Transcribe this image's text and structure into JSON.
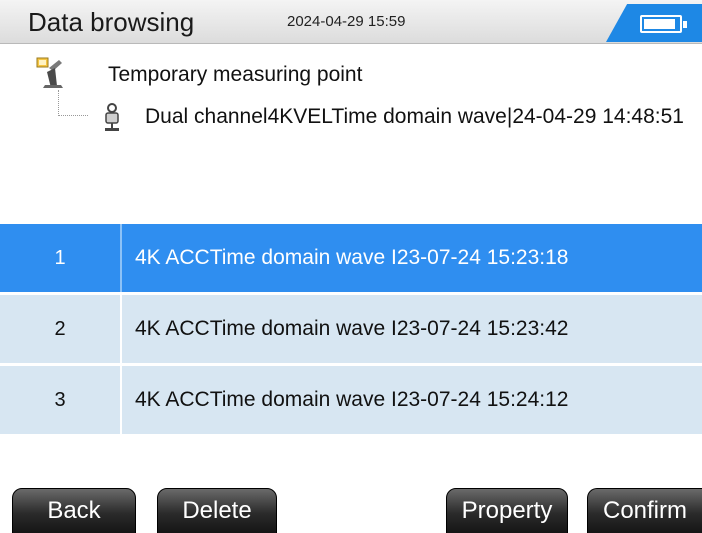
{
  "header": {
    "title": "Data browsing",
    "datetime": "2024-04-29 15:59",
    "battery_level": 0.85,
    "accent_color": "#1e88e5"
  },
  "tree": {
    "root": {
      "label": "Temporary measuring point",
      "icon": "measuring-point-icon"
    },
    "child": {
      "label": "Dual channel4KVELTime domain wave|24-04-29 14:48:51",
      "icon": "sensor-icon"
    }
  },
  "list": {
    "rows": [
      {
        "index": "1",
        "label": "4K ACCTime domain wave I23-07-24 15:23:18",
        "selected": true
      },
      {
        "index": "2",
        "label": "4K ACCTime domain wave I23-07-24 15:23:42",
        "selected": false
      },
      {
        "index": "3",
        "label": "4K ACCTime domain wave I23-07-24 15:24:12",
        "selected": false
      }
    ],
    "selected_color": "#2f8ef0",
    "row_color": "#d7e6f2"
  },
  "buttons": {
    "back": "Back",
    "delete": "Delete",
    "property": "Property",
    "confirm": "Confirm"
  }
}
